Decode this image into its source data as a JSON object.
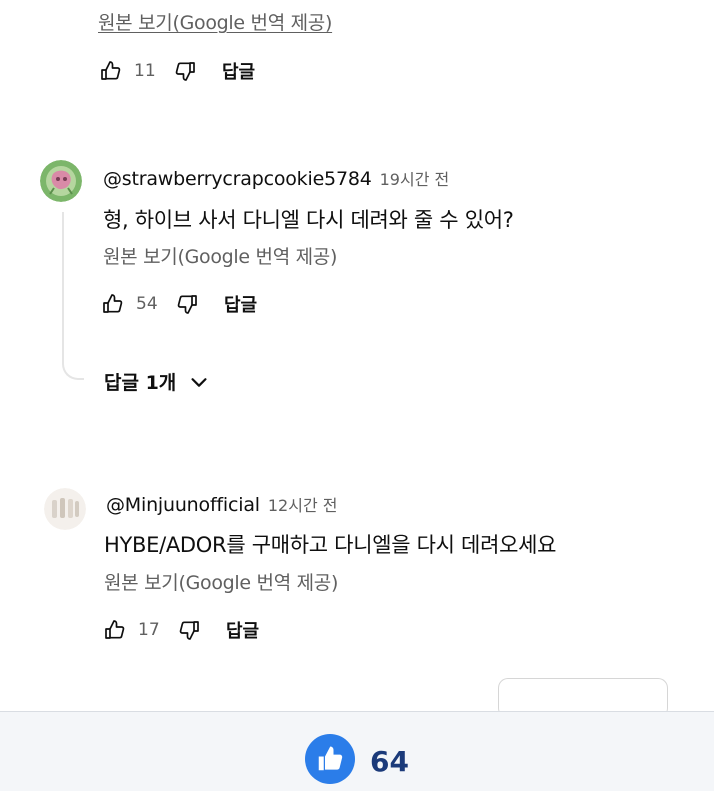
{
  "comments": [
    {
      "see_original": "원본 보기(Google 번역 제공)",
      "likes": "11",
      "reply_label": "답글"
    },
    {
      "author": "@strawberrycrapcookie5784",
      "time": "19시간 전",
      "text": "형, 하이브 사서 다니엘 다시 데려와 줄 수 있어?",
      "see_original": "원본 보기(Google 번역 제공)",
      "likes": "54",
      "reply_label": "답글",
      "replies_toggle": "답글 1개"
    },
    {
      "author": "@Minjuunofficial",
      "time": "12시간 전",
      "text": "HYBE/ADOR를 구매하고 다니엘을 다시 데려오세요",
      "see_original": "원본 보기(Google 번역 제공)",
      "likes": "17",
      "reply_label": "답글"
    }
  ],
  "bottom_bar": {
    "like_count": "64"
  },
  "icons": {
    "like": "thumb-up-icon",
    "dislike": "thumb-down-icon",
    "expand": "chevron-down-icon"
  },
  "colors": {
    "like_button": "#2b7de9",
    "like_count": "#1b3a7a",
    "secondary_text": "#606060"
  }
}
